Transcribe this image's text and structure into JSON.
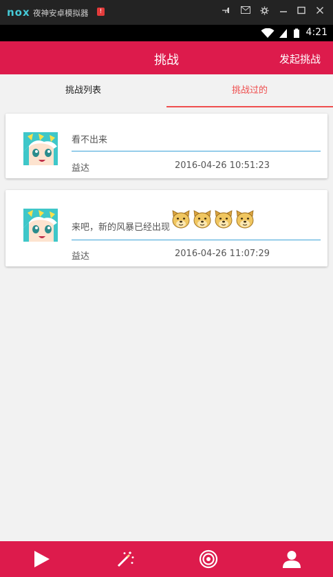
{
  "window": {
    "logo": "nox",
    "title": "夜神安卓模拟器",
    "badge": "!"
  },
  "status_bar": {
    "time": "4:21"
  },
  "app_bar": {
    "title": "挑战",
    "action_label": "发起挑战"
  },
  "tabs": [
    {
      "label": "挑战列表",
      "active": false
    },
    {
      "label": "挑战过的",
      "active": true
    }
  ],
  "challenges": [
    {
      "message": "看不出来",
      "emoji_count": 0,
      "user": "益达",
      "time": "2016-04-26 10:51:23"
    },
    {
      "message": "来吧，新的风暴已经出现",
      "emoji_count": 4,
      "user": "益达",
      "time": "2016-04-26 11:07:29"
    }
  ],
  "bottom_nav": [
    {
      "icon": "play-icon"
    },
    {
      "icon": "magic-wand-icon"
    },
    {
      "icon": "target-icon"
    },
    {
      "icon": "person-icon"
    }
  ],
  "colors": {
    "primary": "#dd1b4c",
    "tab_active": "#ef4d4d",
    "divider": "#3aa2d8",
    "background": "#f2f2f2"
  }
}
